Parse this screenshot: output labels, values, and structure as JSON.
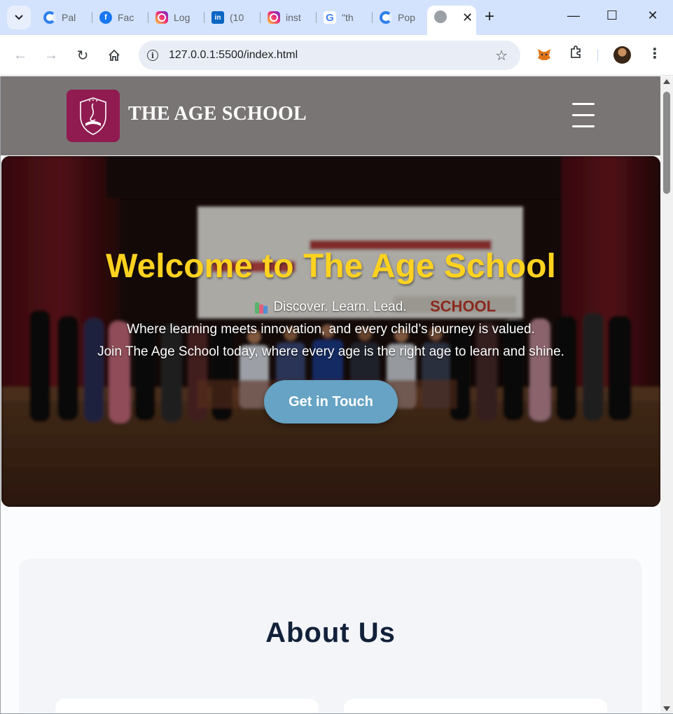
{
  "browser": {
    "tabs": [
      {
        "label": "Pal",
        "icon": "canva-icon"
      },
      {
        "label": "Fac",
        "icon": "facebook-icon"
      },
      {
        "label": "Log",
        "icon": "instagram-icon"
      },
      {
        "label": "(10",
        "icon": "linkedin-icon"
      },
      {
        "label": "inst",
        "icon": "instagram-icon"
      },
      {
        "label": "\"th",
        "icon": "google-icon"
      },
      {
        "label": "Pop",
        "icon": "canva-icon"
      }
    ],
    "active_tab": {
      "label": "",
      "icon": "globe-icon"
    },
    "new_tab_label": "+",
    "url": "127.0.0.1:5500/index.html"
  },
  "site": {
    "title": "THE AGE SCHOOL",
    "logo_icon": "school-crest-icon",
    "brand_color": "#8f1b50",
    "header_color": "#7a7575"
  },
  "hero": {
    "title": "Welcome to The Age School",
    "tagline": "Discover. Learn. Lead.",
    "line1": "Where learning meets innovation, and every child’s journey is valued.",
    "line2": "Join The Age School today, where every age is the right age to learn and shine.",
    "cta_label": "Get in Touch",
    "banner_text": "SCHOOL",
    "title_color": "#ffd21f",
    "cta_color": "#66a3c4"
  },
  "about": {
    "title": "About Us"
  }
}
